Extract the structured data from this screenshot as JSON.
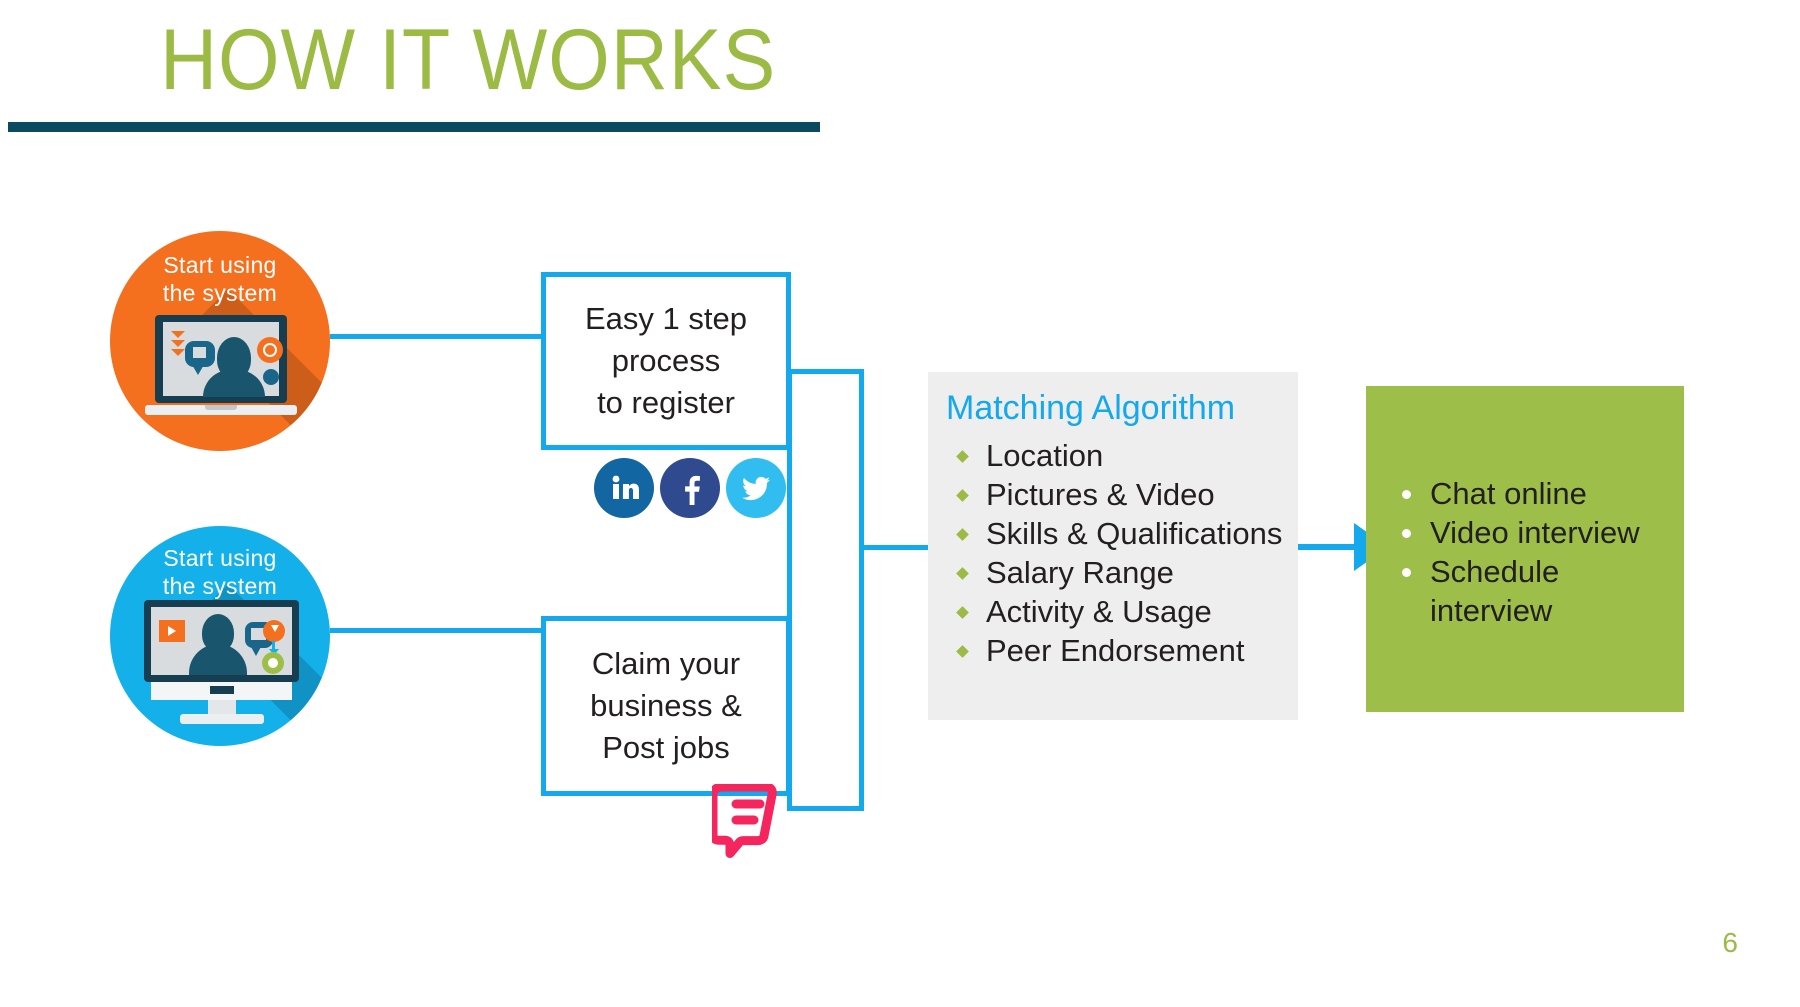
{
  "slide": {
    "title": "HOW IT WORKS",
    "page_number": "6",
    "colors": {
      "title_green": "#9bbb44",
      "rule_navy": "#0b4a61",
      "flow_blue": "#14a8ec",
      "circle_orange": "#f4701f",
      "circle_blue": "#14b0ea",
      "panel_grey": "#eeeeee",
      "green_box": "#9dbf4a",
      "foursquare_pink": "#f5265e"
    }
  },
  "personas": [
    {
      "id": "jobseeker",
      "label": "Start using\nthe system",
      "accent": "#f4701f",
      "device": "laptop-icon"
    },
    {
      "id": "employer",
      "label": "Start using\nthe system",
      "accent": "#14b0ea",
      "device": "desktop-monitor-icon"
    }
  ],
  "flow_boxes": [
    {
      "id": "register",
      "text": "Easy 1 step\nprocess\nto register"
    },
    {
      "id": "claim",
      "text": "Claim your\nbusiness &\nPost jobs"
    }
  ],
  "social_icons": [
    {
      "id": "linkedin",
      "name": "linkedin-icon",
      "glyph": "in",
      "color": "#1266a1"
    },
    {
      "id": "facebook",
      "name": "facebook-icon",
      "glyph": "f",
      "color": "#2f4a8e"
    },
    {
      "id": "twitter",
      "name": "twitter-icon",
      "glyph": "bird",
      "color": "#31bdf0"
    }
  ],
  "foursquare": {
    "name": "foursquare-icon",
    "color": "#f5265e"
  },
  "matching_panel": {
    "title": "Matching Algorithm",
    "items": [
      "Location",
      "Pictures & Video",
      "Skills & Qualifications",
      "Salary Range",
      "Activity & Usage",
      "Peer Endorsement"
    ]
  },
  "outcome_box": {
    "items": [
      "Chat online",
      "Video interview",
      "Schedule\ninterview"
    ]
  }
}
